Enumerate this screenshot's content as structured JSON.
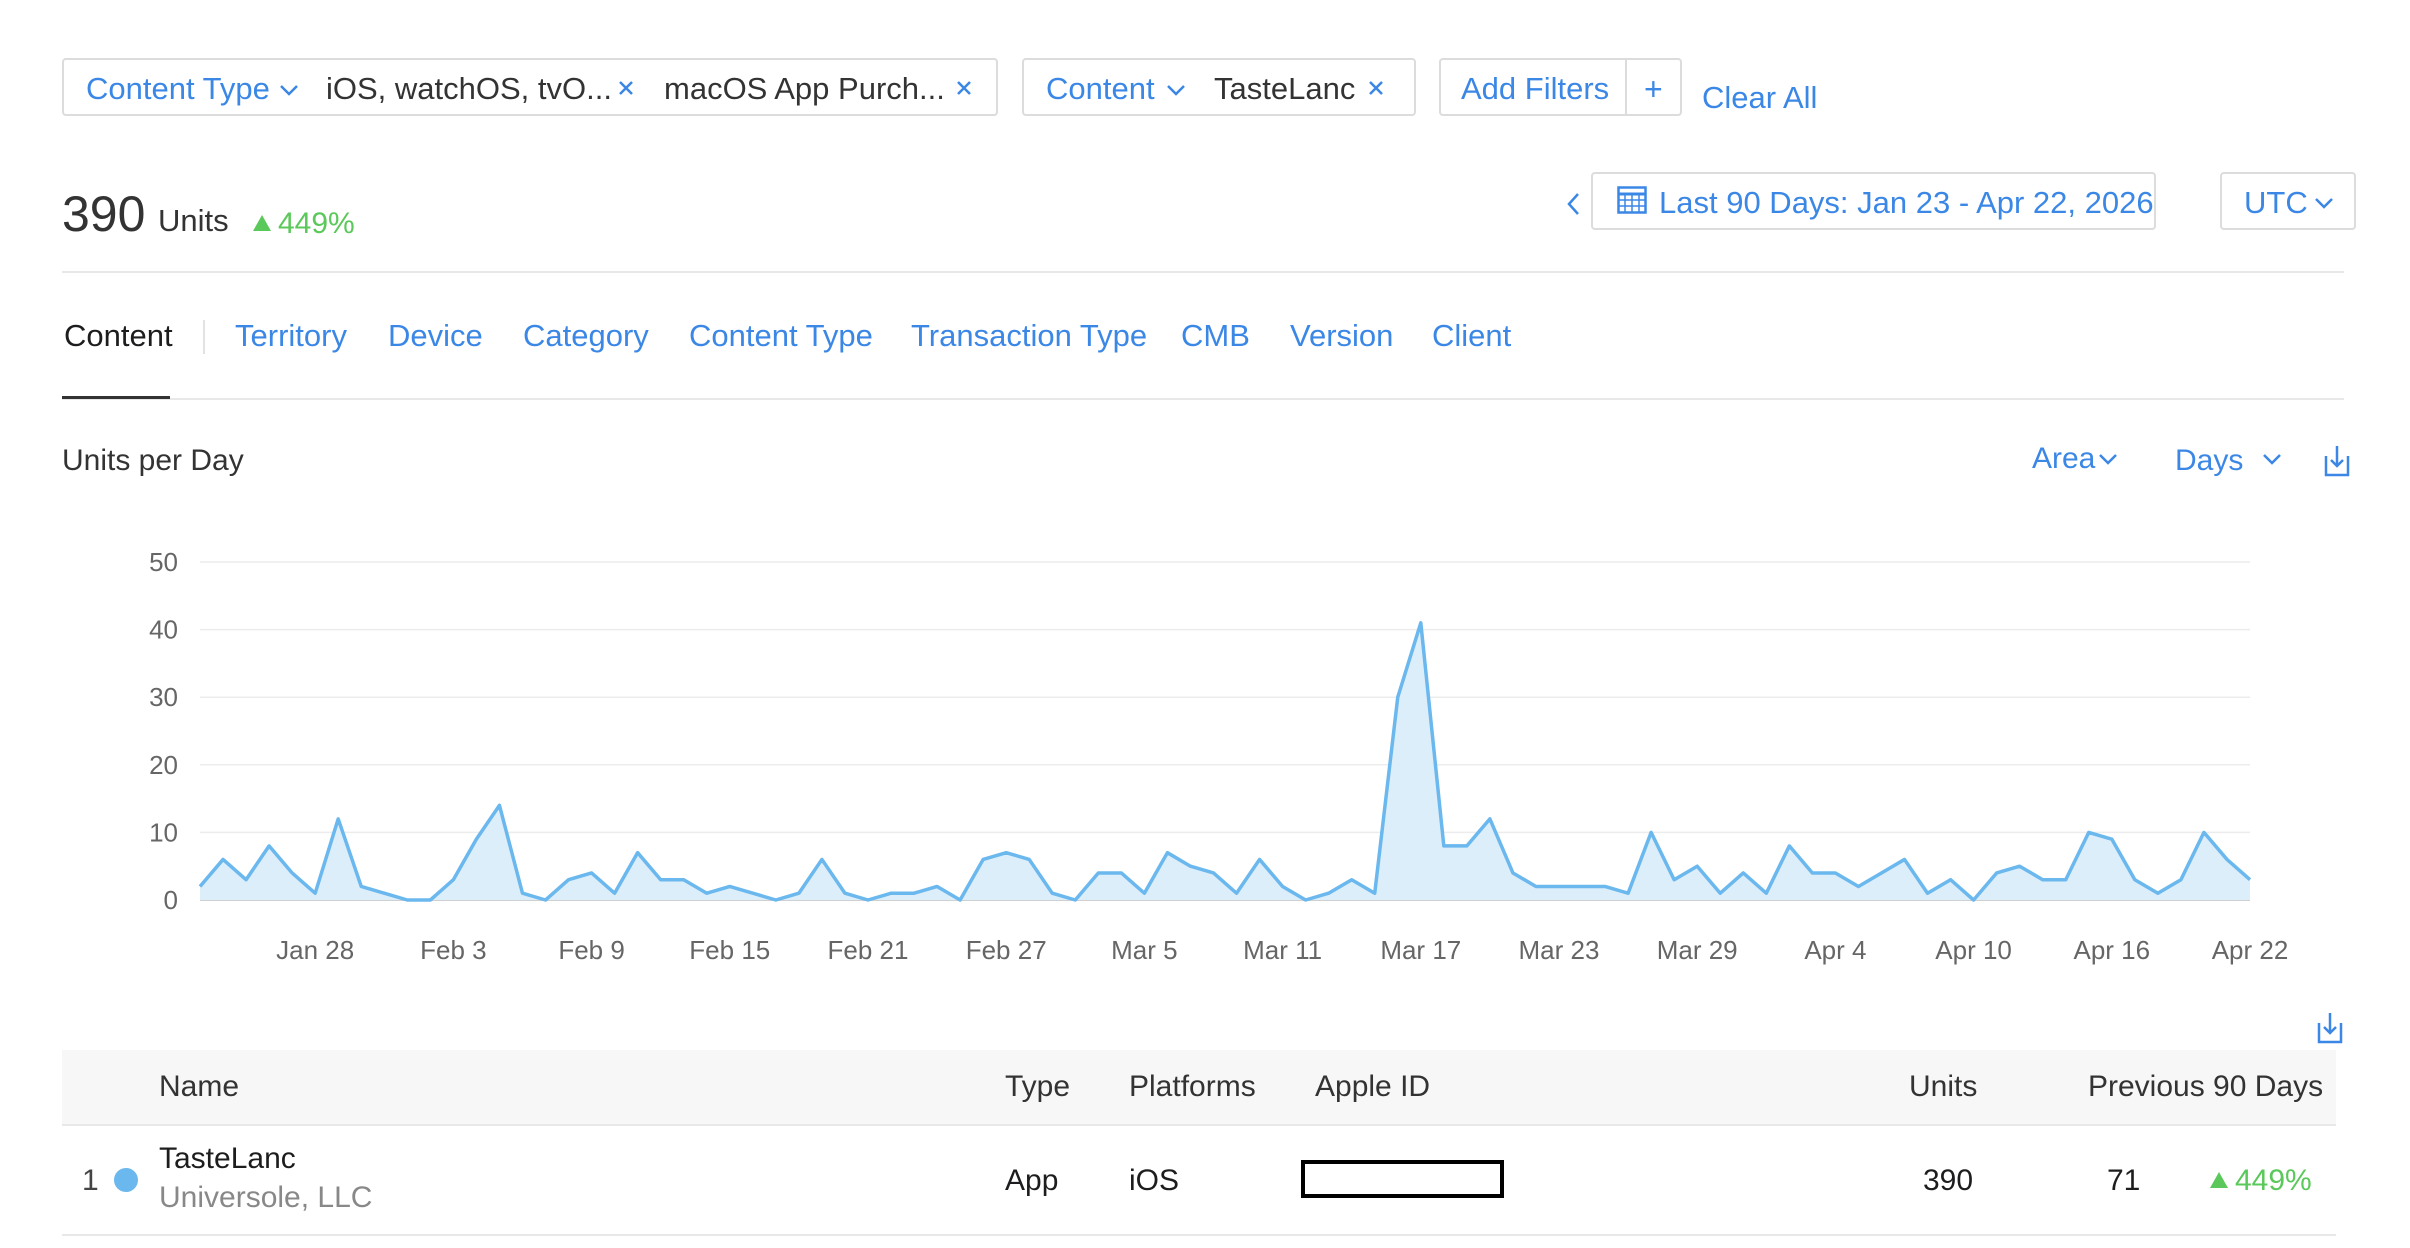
{
  "filters": {
    "content_type": {
      "label": "Content Type",
      "chips": [
        "iOS, watchOS, tvO...",
        "macOS App Purch..."
      ]
    },
    "content": {
      "label": "Content",
      "chips": [
        "TasteLanc"
      ]
    },
    "add_filters_label": "Add Filters",
    "add_icon": "+",
    "clear_all_label": "Clear All"
  },
  "summary": {
    "total": "390",
    "unit_label": "Units",
    "change": "449%",
    "change_color": "#5ac85a"
  },
  "date_range": {
    "label": "Last 90 Days: Jan 23 - Apr 22, 2026"
  },
  "timezone": {
    "label": "UTC"
  },
  "tabs": [
    "Content",
    "Territory",
    "Device",
    "Category",
    "Content Type",
    "Transaction Type",
    "CMB",
    "Version",
    "Client"
  ],
  "chart_controls": {
    "title": "Units per Day",
    "chart_style": "Area",
    "interval": "Days"
  },
  "chart_data": {
    "type": "area",
    "title": "Units per Day",
    "xlabel": "",
    "ylabel": "",
    "ylim": [
      0,
      50
    ],
    "yticks": [
      0,
      10,
      20,
      30,
      40,
      50
    ],
    "x_start": "Jan 23",
    "x_end": "Apr 22",
    "xtick_labels": [
      "Jan 28",
      "Feb 3",
      "Feb 9",
      "Feb 15",
      "Feb 21",
      "Feb 27",
      "Mar 5",
      "Mar 11",
      "Mar 17",
      "Mar 23",
      "Mar 29",
      "Apr 4",
      "Apr 10",
      "Apr 16",
      "Apr 22"
    ],
    "grid": true,
    "color": "#6bb8ee",
    "series": [
      {
        "values": [
          2,
          6,
          3,
          8,
          4,
          1,
          12,
          2,
          1,
          0,
          0,
          3,
          9,
          14,
          1,
          0,
          3,
          4,
          1,
          7,
          3,
          3,
          1,
          2,
          1,
          0,
          1,
          6,
          1,
          0,
          1,
          1,
          2,
          0,
          6,
          7,
          6,
          1,
          0,
          4,
          4,
          1,
          7,
          5,
          4,
          1,
          6,
          2,
          0,
          1,
          3,
          1,
          30,
          41,
          8,
          8,
          12,
          4,
          2,
          2,
          2,
          2,
          1,
          10,
          3,
          5,
          1,
          4,
          1,
          8,
          4,
          4,
          2,
          4,
          6,
          1,
          3,
          0,
          4,
          5,
          3,
          3,
          10,
          9,
          3,
          1,
          3,
          10,
          6,
          3
        ]
      }
    ]
  },
  "table": {
    "columns": [
      "Name",
      "Type",
      "Platforms",
      "Apple ID",
      "Units",
      "Previous 90 Days"
    ],
    "rows": [
      {
        "rank": "1",
        "name": "TasteLanc",
        "developer": "Universole, LLC",
        "type": "App",
        "platforms": "iOS",
        "units": "390",
        "previous": "71",
        "change": "449%",
        "dot_color": "#6bb8ee"
      }
    ]
  }
}
